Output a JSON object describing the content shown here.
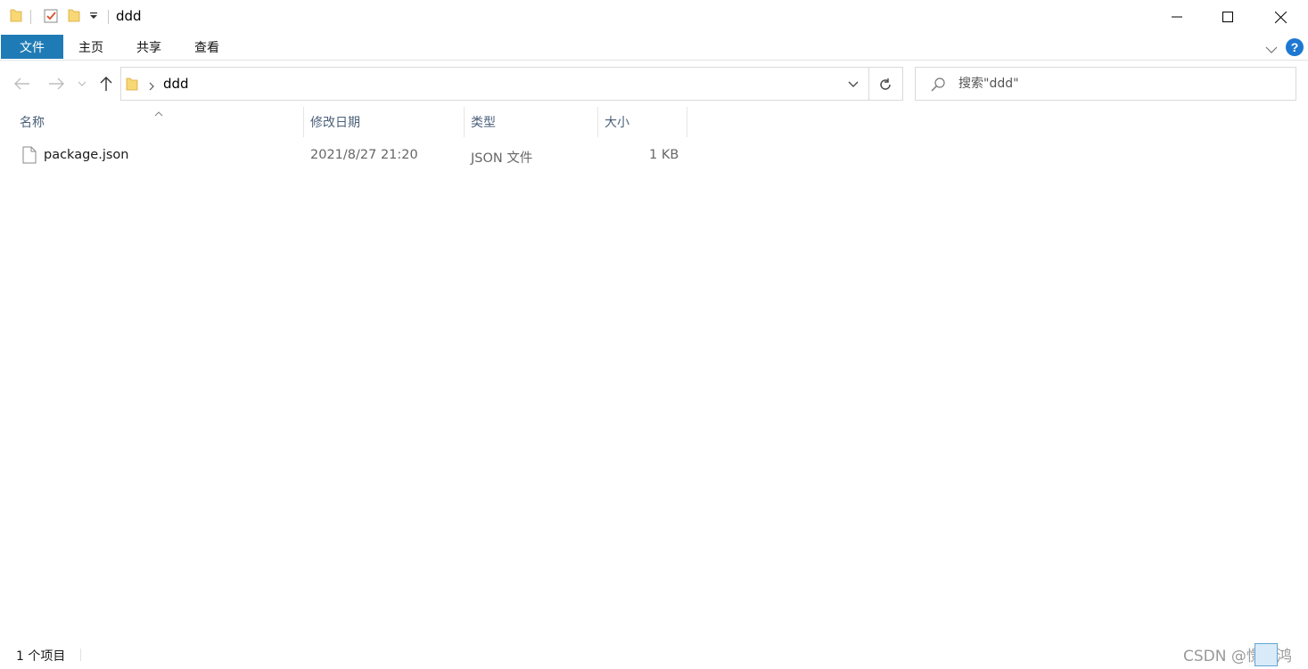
{
  "window": {
    "title": "ddd",
    "controls": {
      "minimize": "minimize",
      "maximize": "maximize",
      "close": "close"
    }
  },
  "ribbon": {
    "tabs": [
      {
        "label": "文件",
        "active": true
      },
      {
        "label": "主页"
      },
      {
        "label": "共享"
      },
      {
        "label": "查看"
      }
    ]
  },
  "navigation": {
    "address": {
      "segments": [
        "ddd"
      ]
    },
    "search": {
      "placeholder": "搜索\"ddd\""
    }
  },
  "columns": [
    "名称",
    "修改日期",
    "类型",
    "大小"
  ],
  "files": [
    {
      "name": "package.json",
      "modified": "2021/8/27 21:20",
      "type": "JSON 文件",
      "size": "1 KB"
    }
  ],
  "status": {
    "item_count": "1 个项目"
  },
  "watermark": "CSDN @憬玄鸿",
  "colors": {
    "file_tab": "#1f7bb5",
    "folder": "#f8d775",
    "help": "#1e78d2"
  }
}
